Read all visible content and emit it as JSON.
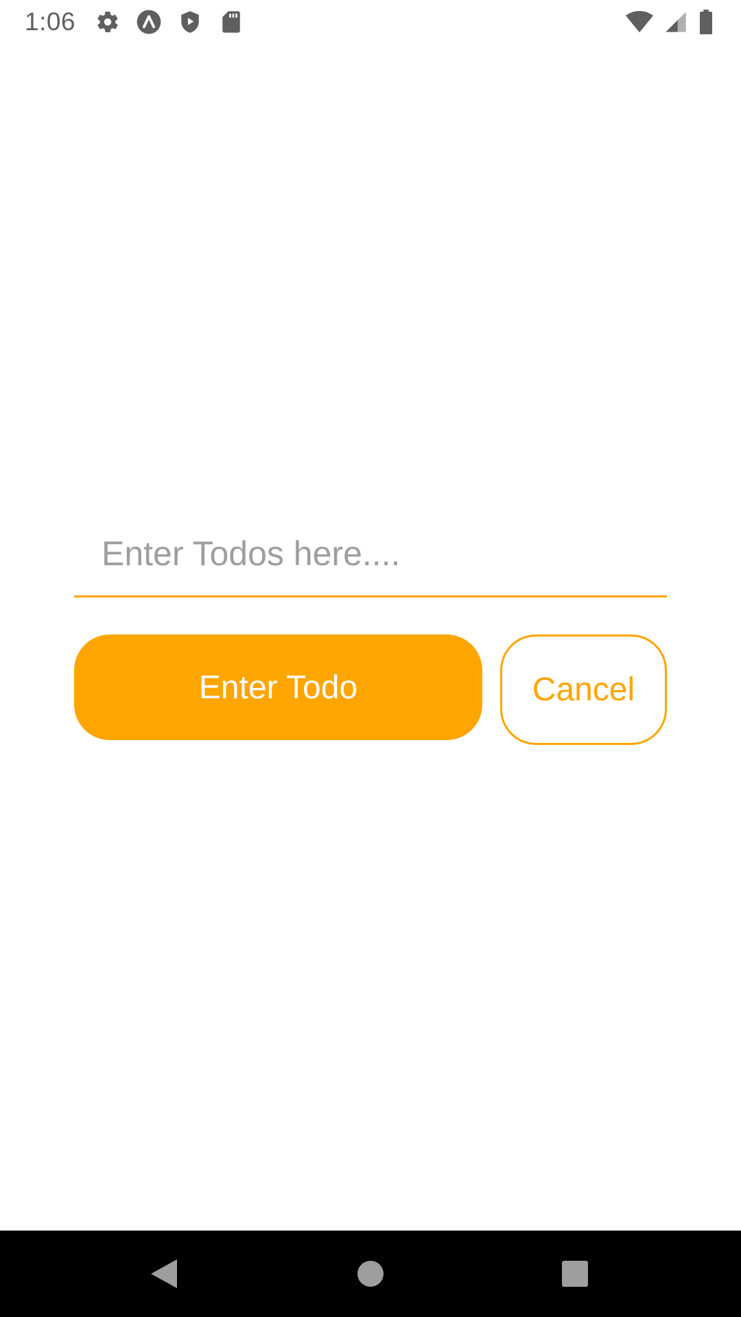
{
  "status_bar": {
    "time": "1:06",
    "left_icons": [
      "gear-icon",
      "expo-icon",
      "play-shield-icon",
      "sd-card-icon"
    ],
    "right_icons": [
      "wifi-icon",
      "cellular-signal-icon",
      "battery-icon"
    ]
  },
  "todo_input": {
    "value": "",
    "placeholder": "Enter Todos here...."
  },
  "actions": {
    "enter_label": "Enter Todo",
    "cancel_label": "Cancel"
  },
  "colors": {
    "accent": "#ffa500",
    "placeholder": "#9e9e9e",
    "status_icon": "#5f5f5f",
    "nav_background": "#000000",
    "nav_icon": "#9e9e9e"
  },
  "nav_bar": {
    "buttons": [
      "back-icon",
      "home-icon",
      "recents-icon"
    ]
  }
}
